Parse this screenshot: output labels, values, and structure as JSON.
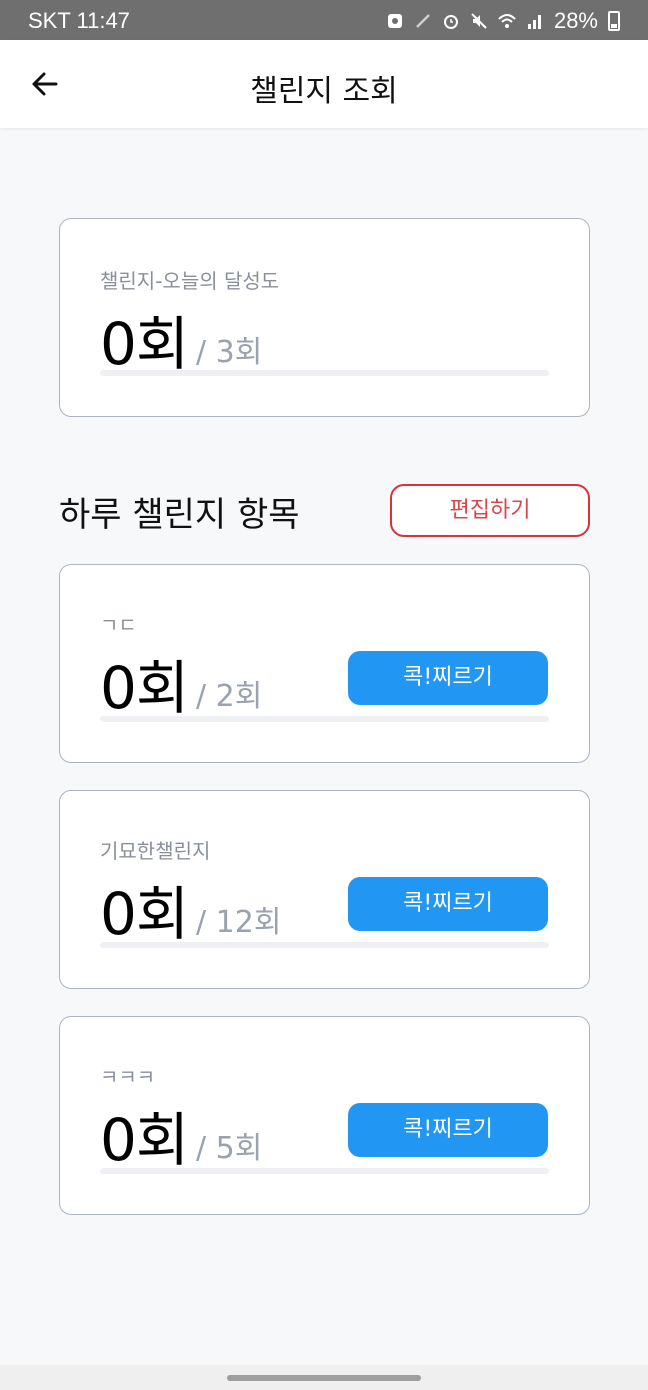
{
  "status_bar": {
    "carrier_time": "SKT 11:47",
    "battery": "28%",
    "icons": [
      "recycle-icon",
      "pen-icon",
      "alarm-icon",
      "mute-icon",
      "wifi-icon",
      "signal-icon",
      "battery-icon"
    ]
  },
  "app_bar": {
    "title": "챌린지 조회",
    "back_icon": "arrow-left-icon"
  },
  "summary": {
    "label": "챌린지-오늘의 달성도",
    "count": "0회",
    "goal": "/ 3회",
    "progress": 0
  },
  "section": {
    "title": "하루 챌린지 항목",
    "edit_label": "편집하기"
  },
  "items": [
    {
      "label": "ㄱㄷ",
      "count": "0회",
      "goal": "/ 2회",
      "poke_label": "콕!찌르기",
      "progress": 0
    },
    {
      "label": "기묘한챌린지",
      "count": "0회",
      "goal": "/ 12회",
      "poke_label": "콕!찌르기",
      "progress": 0
    },
    {
      "label": "ㅋㅋㅋ",
      "count": "0회",
      "goal": "/ 5회",
      "poke_label": "콕!찌르기",
      "progress": 0
    }
  ],
  "colors": {
    "accent": "#2196f3",
    "edit_border": "#d6333a",
    "background": "#f7f8fa"
  }
}
